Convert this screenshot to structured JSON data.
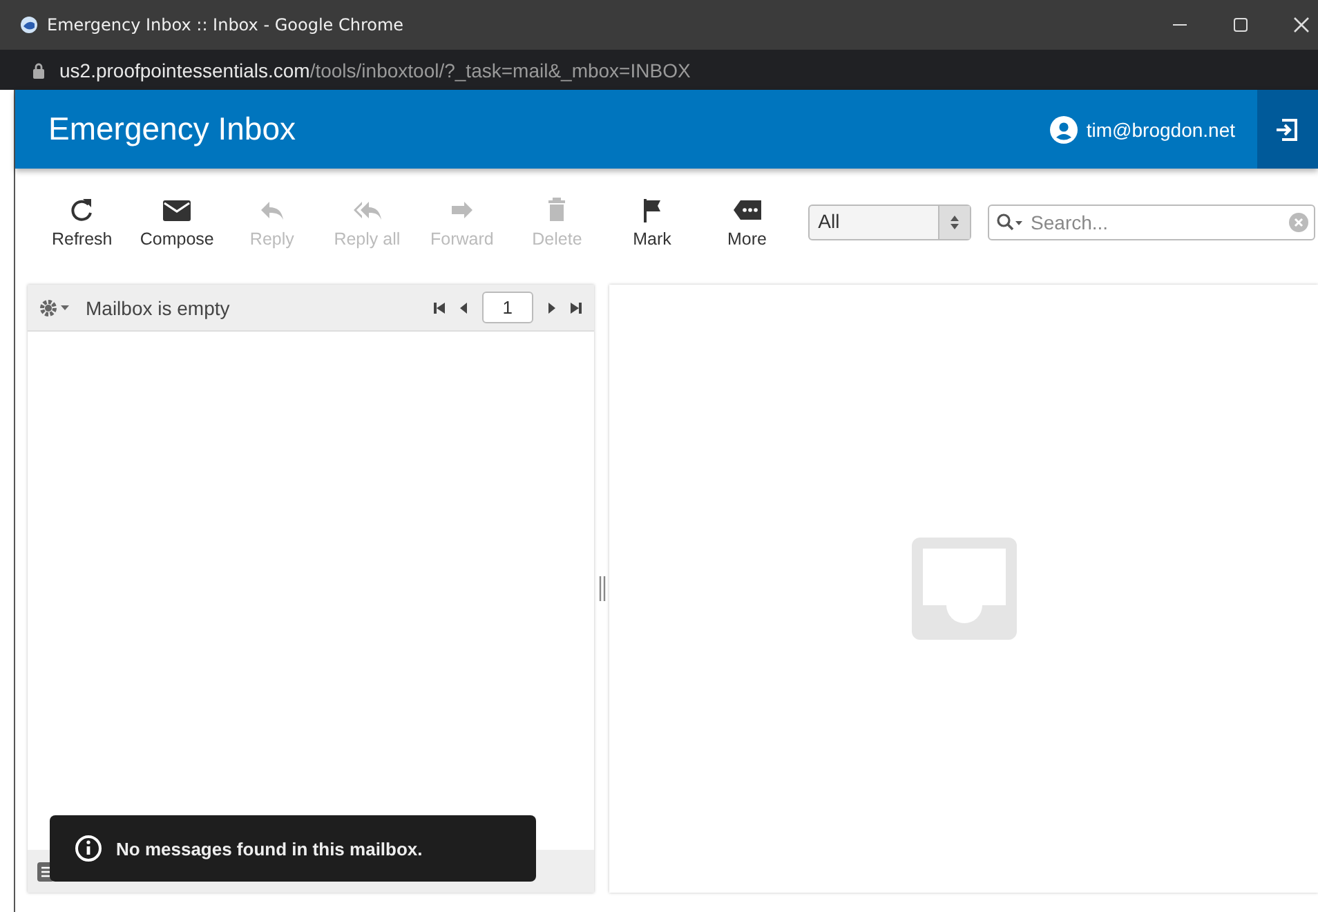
{
  "window": {
    "title": "Emergency Inbox :: Inbox - Google Chrome"
  },
  "address_bar": {
    "host": "us2.proofpointessentials.com",
    "path": "/tools/inboxtool/?_task=mail&_mbox=INBOX"
  },
  "header": {
    "title": "Emergency Inbox",
    "user": "tim@brogdon.net"
  },
  "toolbar": [
    {
      "kind": "refresh",
      "label": "Refresh",
      "disabled": false
    },
    {
      "kind": "compose",
      "label": "Compose",
      "disabled": false
    },
    {
      "kind": "reply",
      "label": "Reply",
      "disabled": true
    },
    {
      "kind": "replyall",
      "label": "Reply all",
      "disabled": true
    },
    {
      "kind": "forward",
      "label": "Forward",
      "disabled": true
    },
    {
      "kind": "delete",
      "label": "Delete",
      "disabled": true
    },
    {
      "kind": "mark",
      "label": "Mark",
      "disabled": false
    },
    {
      "kind": "more",
      "label": "More",
      "disabled": false
    }
  ],
  "filter": {
    "value": "All"
  },
  "search": {
    "placeholder": "Search..."
  },
  "message_list": {
    "status": "Mailbox is empty",
    "page": "1"
  },
  "toast": {
    "message": "No messages found in this mailbox."
  }
}
